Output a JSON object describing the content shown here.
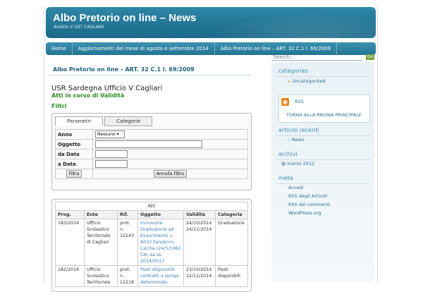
{
  "header": {
    "title": "Albo Pretorio on line – News",
    "description": "Ambito V UST CAGLIARI"
  },
  "nav": {
    "items": [
      {
        "label": "Home"
      },
      {
        "label": "Aggiornamenti del mese di agosto e settembre 2014"
      },
      {
        "label": "Albo Pretorio on line – ART. 32 C.1 l. 69/2009"
      }
    ]
  },
  "search": {
    "placeholder": "Search...",
    "go_label": "Go"
  },
  "content": {
    "subtitle": "Albo Pretorio on line – ART. 32 C.1 l. 69/2009",
    "office": "USR Sardegna Ufficio V Cagliari",
    "atti_label": "Atti in corso di Validità",
    "filtri_label": "Filtri",
    "tabs": [
      "Parametri",
      "Categorie"
    ],
    "filters": {
      "anno_label": "Anno",
      "anno_value": "Nessuno",
      "oggetto_label": "Oggetto",
      "da_data_label": "da Data",
      "a_data_label": "a Data",
      "filtra_button": "Filtra",
      "annulla_button": "Annulla Filtro"
    },
    "atti_table": {
      "caption": "Atti",
      "headers": [
        "Prog.",
        "Ente",
        "Rif.",
        "Oggetto",
        "Validità",
        "Categoria"
      ],
      "rows": [
        {
          "prog": "183/2014",
          "ente": "Ufficio Scolastico Territoriale di Cagliari",
          "rif": "prot. n. 12243",
          "oggetto": "Inclusione Graduatorie ad Esaurimento c. A032 Fanzecco Cecilia (24/5/1962 CA) aa.ss. 2014/2017",
          "validita_from": "24/10/2014",
          "validita_to": "24/11/2014",
          "categoria": "Graduatorie"
        },
        {
          "prog": "182/2014",
          "ente": "Ufficio Scolastico Territoriale",
          "rif": "prot. n. 12218",
          "oggetto": "Posti disponibili contratti a tempo determinato",
          "validita_from": "23/10/2014",
          "validita_to": "22/11/2014",
          "categoria": "Posti disponibili"
        }
      ]
    }
  },
  "sidebar": {
    "categorie_title": "categories",
    "categorie_items": [
      "Uncategorized"
    ],
    "rss_label": "RSS",
    "torna_label": "TORNA ALLA PAGINA PRINCIPALE",
    "articoli_title": "articoli recenti",
    "articoli_items": [
      "News"
    ],
    "archivi_title": "archivi",
    "archivi_items": [
      "marzo 2012"
    ],
    "meta_title": "meta",
    "meta_items": [
      "Accedi",
      "RSS degli Articoli",
      "RSS dei commenti",
      "WordPress.org"
    ]
  },
  "colors": {
    "header": "#2f86a6",
    "accent_green": "#2a8a1e",
    "link": "#3a7fb6"
  }
}
